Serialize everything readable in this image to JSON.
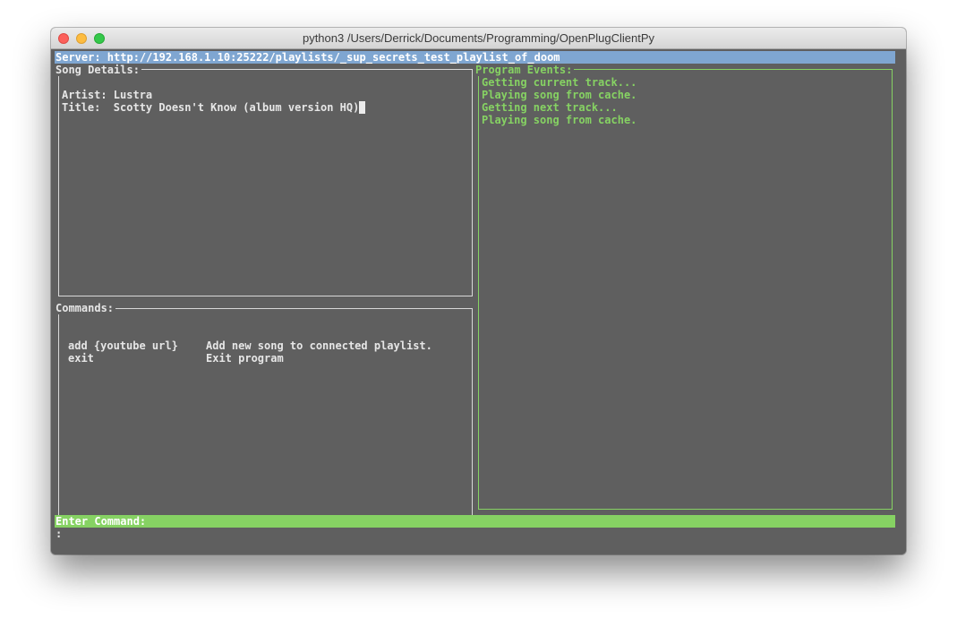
{
  "window": {
    "title": "python3  /Users/Derrick/Documents/Programming/OpenPlugClientPy"
  },
  "server": {
    "text": "Server: http://192.168.1.10:25222/playlists/_sup_secrets_test_playlist_of_doom"
  },
  "song_details": {
    "label": "Song Details:",
    "artist_line": "Artist: Lustra",
    "title_line": "Title:  Scotty Doesn't Know (album version HQ)"
  },
  "commands": {
    "label": "Commands:",
    "items": [
      {
        "command": "add {youtube url}",
        "description": "Add new song to connected playlist."
      },
      {
        "command": "exit",
        "description": "Exit program"
      }
    ]
  },
  "program_events": {
    "label": "Program Events:",
    "lines": [
      "Getting current track...",
      "Playing song from cache.",
      "Getting next track...",
      "Playing song from cache."
    ]
  },
  "input": {
    "label": "Enter Command:",
    "prompt": ":"
  },
  "colors": {
    "terminal_bg": "#5f5f5f",
    "server_bar": "#7fa6d1",
    "accent_green": "#86d263",
    "text": "#e6e6e6"
  }
}
